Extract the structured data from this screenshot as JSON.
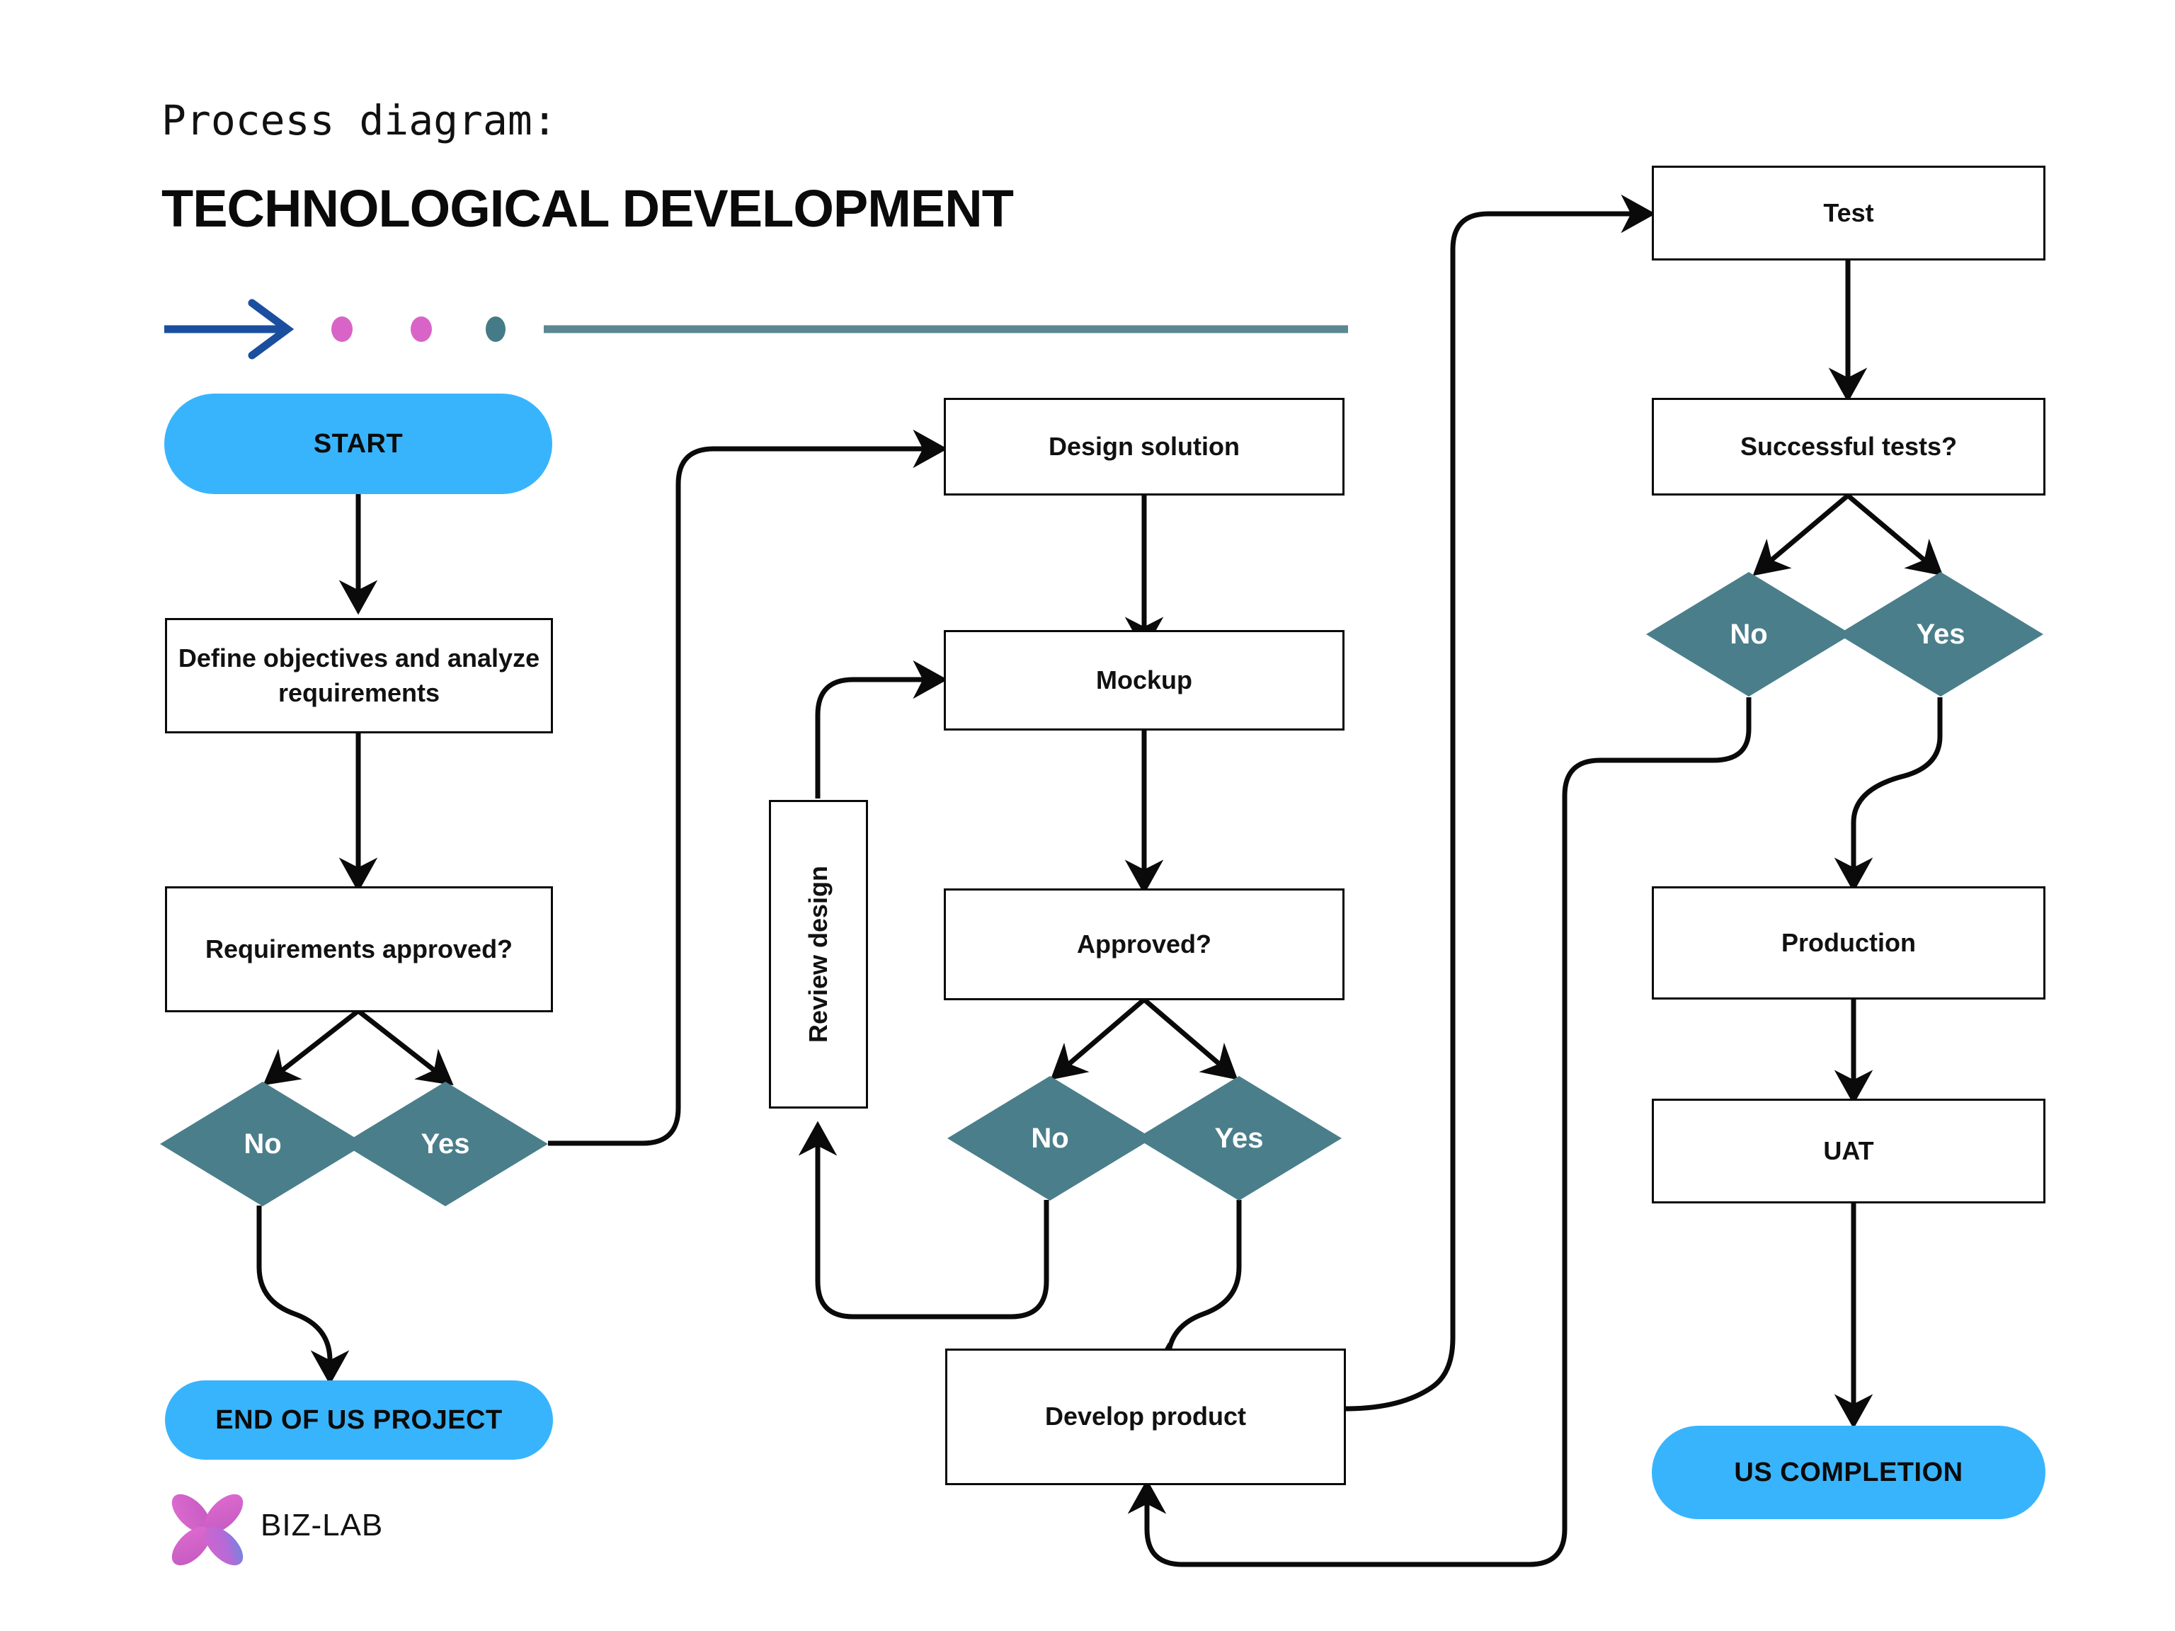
{
  "header": {
    "kicker": "Process diagram:",
    "title": "TECHNOLOGICAL DEVELOPMENT"
  },
  "decoration": {
    "arrow_color": "#1a4fa0",
    "dot_colors": [
      "#d964c8",
      "#d964c8",
      "#457b86"
    ],
    "rule_color": "#5a8792"
  },
  "palette": {
    "terminator_fill": "#38b4fd",
    "decision_fill": "#4a7e8b",
    "decision_text": "#ffffff",
    "box_stroke": "#0a0a0a",
    "box_fill": "#ffffff",
    "text": "#111111"
  },
  "nodes": {
    "start": {
      "label": "START",
      "type": "terminator"
    },
    "define_objectives": {
      "label": "Define objectives and analyze requirements",
      "type": "process"
    },
    "requirements_approved": {
      "label": "Requirements approved?",
      "type": "decision-question"
    },
    "req_no": {
      "label": "No",
      "type": "decision"
    },
    "req_yes": {
      "label": "Yes",
      "type": "decision"
    },
    "end_project": {
      "label": "END OF US PROJECT",
      "type": "terminator"
    },
    "design_solution": {
      "label": "Design solution",
      "type": "process"
    },
    "mockup": {
      "label": "Mockup",
      "type": "process"
    },
    "review_design": {
      "label": "Review design",
      "type": "process-vertical"
    },
    "approved": {
      "label": "Approved?",
      "type": "decision-question"
    },
    "appr_no": {
      "label": "No",
      "type": "decision"
    },
    "appr_yes": {
      "label": "Yes",
      "type": "decision"
    },
    "develop_product": {
      "label": "Develop product",
      "type": "process"
    },
    "test": {
      "label": "Test",
      "type": "process"
    },
    "successful_tests": {
      "label": "Successful tests?",
      "type": "decision-question"
    },
    "test_no": {
      "label": "No",
      "type": "decision"
    },
    "test_yes": {
      "label": "Yes",
      "type": "decision"
    },
    "production": {
      "label": "Production",
      "type": "process"
    },
    "uat": {
      "label": "UAT",
      "type": "process"
    },
    "completion": {
      "label": "US COMPLETION",
      "type": "terminator"
    }
  },
  "footer": {
    "brand": "BIZ-LAB"
  },
  "flow_edges": [
    {
      "from": "start",
      "to": "define_objectives"
    },
    {
      "from": "define_objectives",
      "to": "requirements_approved"
    },
    {
      "from": "requirements_approved",
      "to": "req_no"
    },
    {
      "from": "requirements_approved",
      "to": "req_yes"
    },
    {
      "from": "req_no",
      "to": "end_project"
    },
    {
      "from": "req_yes",
      "to": "design_solution"
    },
    {
      "from": "design_solution",
      "to": "mockup"
    },
    {
      "from": "mockup",
      "to": "approved"
    },
    {
      "from": "approved",
      "to": "appr_no"
    },
    {
      "from": "approved",
      "to": "appr_yes"
    },
    {
      "from": "appr_no",
      "to": "review_design"
    },
    {
      "from": "review_design",
      "to": "mockup"
    },
    {
      "from": "appr_yes",
      "to": "develop_product"
    },
    {
      "from": "develop_product",
      "to": "test"
    },
    {
      "from": "test",
      "to": "successful_tests"
    },
    {
      "from": "successful_tests",
      "to": "test_no"
    },
    {
      "from": "successful_tests",
      "to": "test_yes"
    },
    {
      "from": "test_no",
      "to": "develop_product"
    },
    {
      "from": "test_yes",
      "to": "production"
    },
    {
      "from": "production",
      "to": "uat"
    },
    {
      "from": "uat",
      "to": "completion"
    }
  ]
}
